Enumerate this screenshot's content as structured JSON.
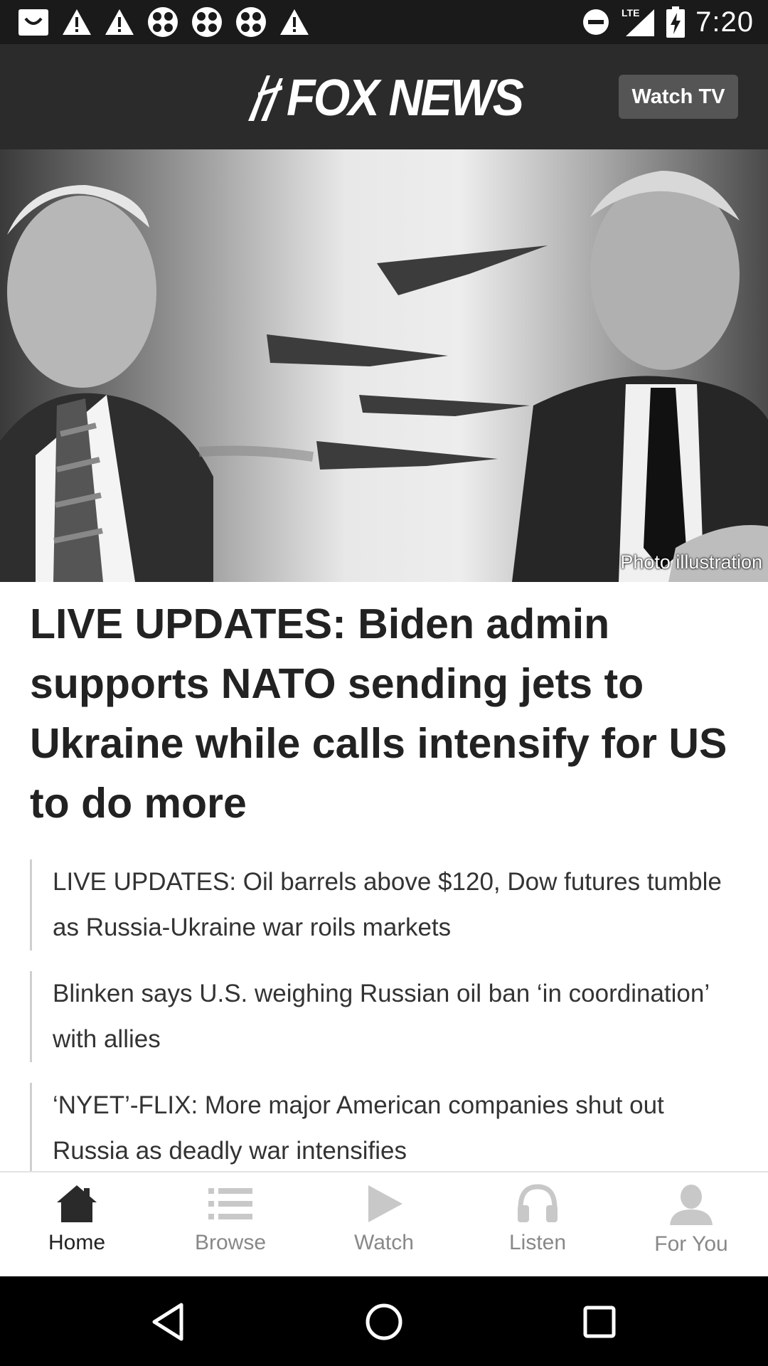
{
  "status_bar": {
    "time": "7:20",
    "network": "LTE",
    "left_icons": [
      "app-notification-icon",
      "warning-icon",
      "warning-icon",
      "fan-icon",
      "fan-icon",
      "fan-icon",
      "warning-icon"
    ],
    "right_icons": [
      "do-not-disturb-icon",
      "signal-icon",
      "battery-charging-icon"
    ]
  },
  "header": {
    "logo_text": "FOX NEWS",
    "watch_tv_label": "Watch TV",
    "background_color": "#2b2b2b"
  },
  "hero": {
    "caption": "Photo illustration"
  },
  "main": {
    "headline": "LIVE UPDATES: Biden admin supports NATO sending jets to Ukraine while calls intensify for US to do more",
    "related": [
      "LIVE UPDATES: Oil barrels above $120, Dow futures tumble as Russia-Ukraine war roils markets",
      "Blinken says U.S. weighing Russian oil ban ‘in coordination’ with allies",
      "‘NYET’-FLIX: More major American companies shut out Russia as deadly war intensifies"
    ]
  },
  "tabs": [
    {
      "label": "Home",
      "icon": "home-icon",
      "active": true
    },
    {
      "label": "Browse",
      "icon": "list-icon",
      "active": false
    },
    {
      "label": "Watch",
      "icon": "play-icon",
      "active": false
    },
    {
      "label": "Listen",
      "icon": "headphones-icon",
      "active": false
    },
    {
      "label": "For You",
      "icon": "person-icon",
      "active": false
    }
  ],
  "system_nav": [
    "back-icon",
    "home-circle-icon",
    "recents-icon"
  ],
  "colors": {
    "active_tab": "#222222",
    "inactive_tab": "#888888",
    "header_bg": "#2b2b2b"
  }
}
